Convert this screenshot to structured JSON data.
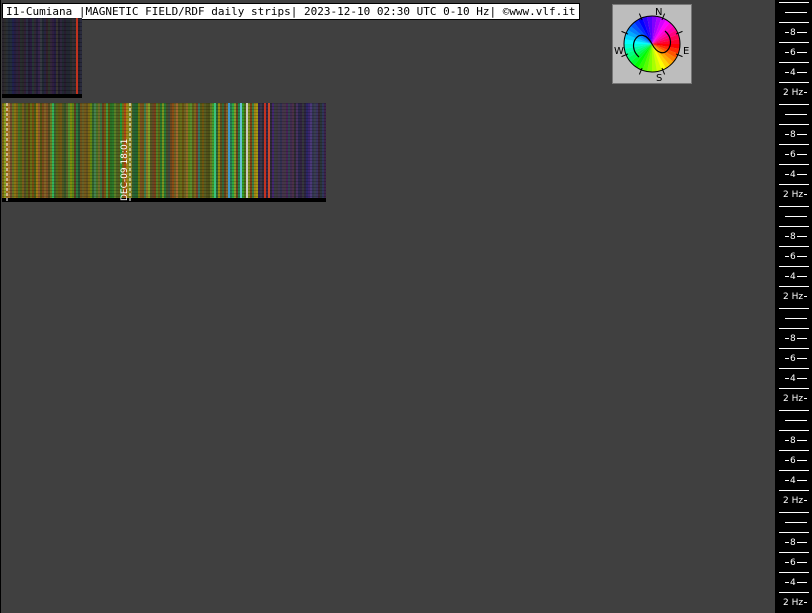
{
  "header": {
    "title": "I1-Cumiana |MAGNETIC FIELD/RDF daily strips| 2023-12-10 02:30 UTC 0-10 Hz| ©www.vlf.it"
  },
  "strips": {
    "main_marker_label": "DEC-09 18:01"
  },
  "compass": {
    "north": "N",
    "east": "E",
    "south": "S",
    "west": "W"
  },
  "scale": {
    "tick_labels": [
      "8",
      "6",
      "4",
      "2 Hz"
    ],
    "block_count": 6
  },
  "colors": {
    "background": "#404040",
    "scale_background": "#000000",
    "scale_text": "#ffffff",
    "marker_line": "#ffffff"
  }
}
